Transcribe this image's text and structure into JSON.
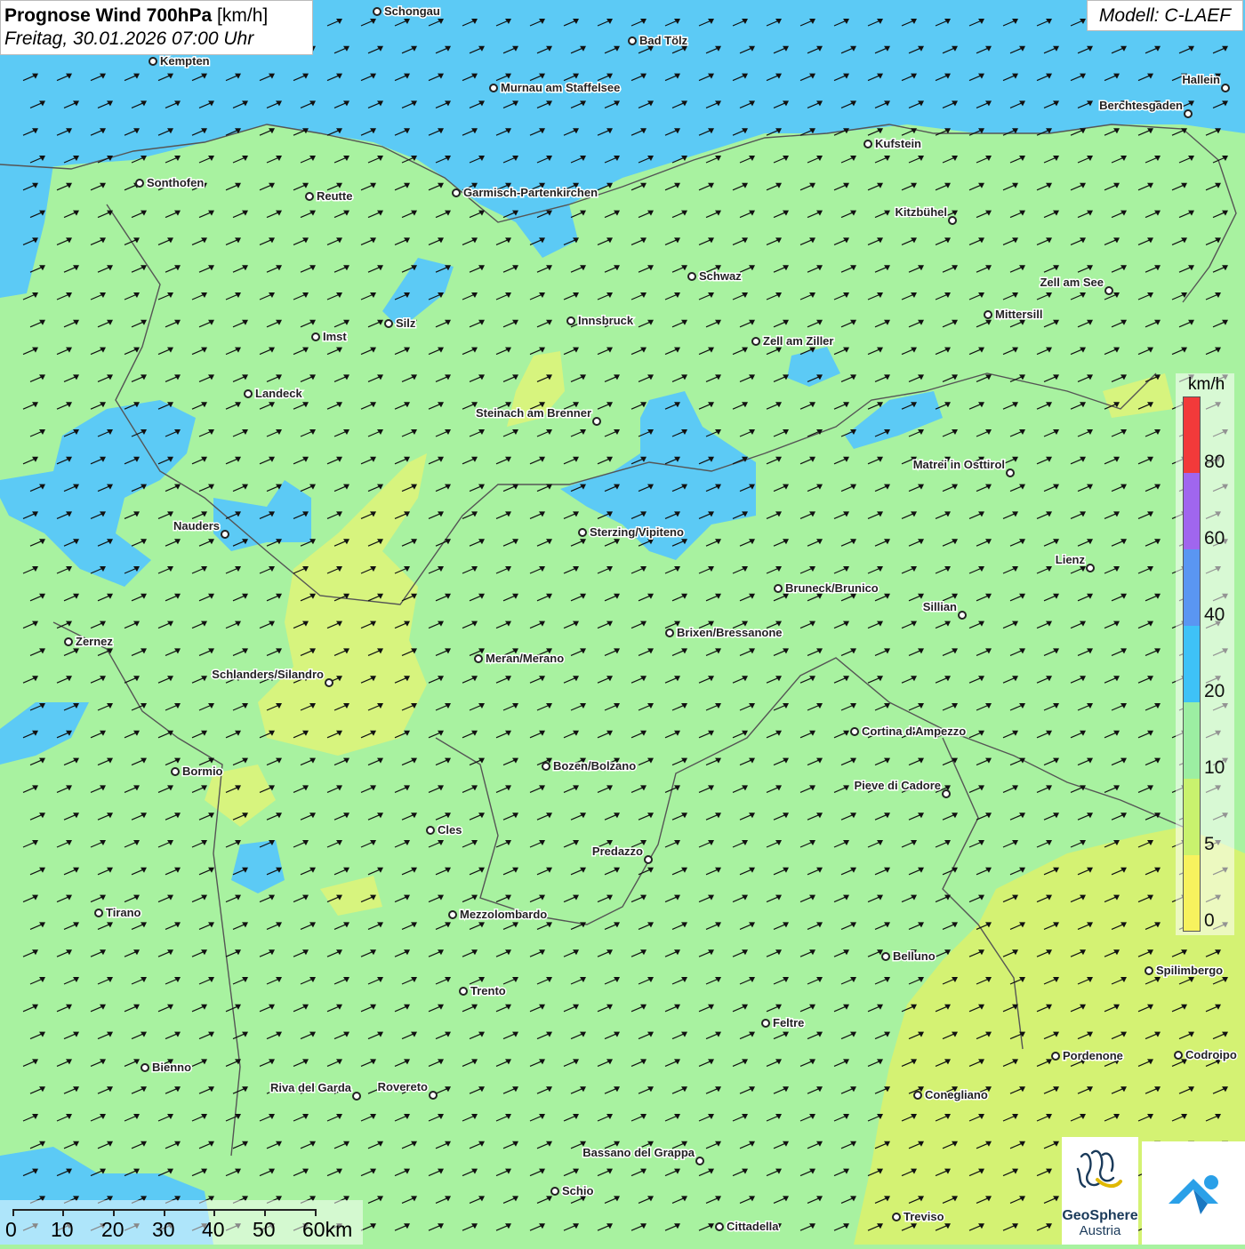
{
  "header": {
    "title_bold": "Prognose Wind 700hPa",
    "title_unit": "[km/h]",
    "datetime": "Freitag, 30.01.2026 07:00 Uhr",
    "model": "Modell: C-LAEF"
  },
  "legend": {
    "unit": "km/h",
    "ticks": [
      "80",
      "60",
      "40",
      "20",
      "10",
      "5",
      "0"
    ],
    "colors": [
      "#f23a3a",
      "#a066ee",
      "#5a96f2",
      "#3ec2f7",
      "#9ceea2",
      "#c9f26e",
      "#f7f25e"
    ]
  },
  "scale_bar": {
    "labels": [
      "0",
      "10",
      "20",
      "30",
      "40",
      "50",
      "60km"
    ]
  },
  "logos": {
    "geosphere_line1": "GeoSphere",
    "geosphere_line2": "Austria",
    "icon_names": [
      "geosphere-logo-icon",
      "app-logo-icon"
    ]
  },
  "map": {
    "base_color": "#a8f2a0",
    "arrow_direction": "north-east",
    "cities": [
      {
        "name": "Schongau"
      },
      {
        "name": "Bad Tölz"
      },
      {
        "name": "Kempten"
      },
      {
        "name": "Murnau am Staffelsee"
      },
      {
        "name": "Hallein"
      },
      {
        "name": "Berchtesgaden"
      },
      {
        "name": "Kufstein"
      },
      {
        "name": "Sonthofen"
      },
      {
        "name": "Reutte"
      },
      {
        "name": "Garmisch-Partenkirchen"
      },
      {
        "name": "Kitzbühel"
      },
      {
        "name": "Schwaz"
      },
      {
        "name": "Zell am See"
      },
      {
        "name": "Mittersill"
      },
      {
        "name": "Silz"
      },
      {
        "name": "Innsbruck"
      },
      {
        "name": "Imst"
      },
      {
        "name": "Zell am Ziller"
      },
      {
        "name": "Landeck"
      },
      {
        "name": "Steinach am Brenner"
      },
      {
        "name": "Matrei in Osttirol"
      },
      {
        "name": "Nauders"
      },
      {
        "name": "Sterzing/Vipiteno"
      },
      {
        "name": "Lienz"
      },
      {
        "name": "Bruneck/Brunico"
      },
      {
        "name": "Sillian"
      },
      {
        "name": "Zernez"
      },
      {
        "name": "Brixen/Bressanone"
      },
      {
        "name": "Meran/Merano"
      },
      {
        "name": "Schlanders/Silandro"
      },
      {
        "name": "Cortina d'Ampezzo"
      },
      {
        "name": "Bozen/Bolzano"
      },
      {
        "name": "Bormio"
      },
      {
        "name": "Pieve di Cadore"
      },
      {
        "name": "Cles"
      },
      {
        "name": "Predazzo"
      },
      {
        "name": "Tirano"
      },
      {
        "name": "Mezzolombardo"
      },
      {
        "name": "Belluno"
      },
      {
        "name": "Spilimbergo"
      },
      {
        "name": "Trento"
      },
      {
        "name": "Feltre"
      },
      {
        "name": "Pordenone"
      },
      {
        "name": "Codroipo"
      },
      {
        "name": "Bienno"
      },
      {
        "name": "Riva del Garda"
      },
      {
        "name": "Rovereto"
      },
      {
        "name": "Conegliano"
      },
      {
        "name": "Bassano del Grappa"
      },
      {
        "name": "Schio"
      },
      {
        "name": "Treviso"
      },
      {
        "name": "Cittadella"
      }
    ]
  }
}
